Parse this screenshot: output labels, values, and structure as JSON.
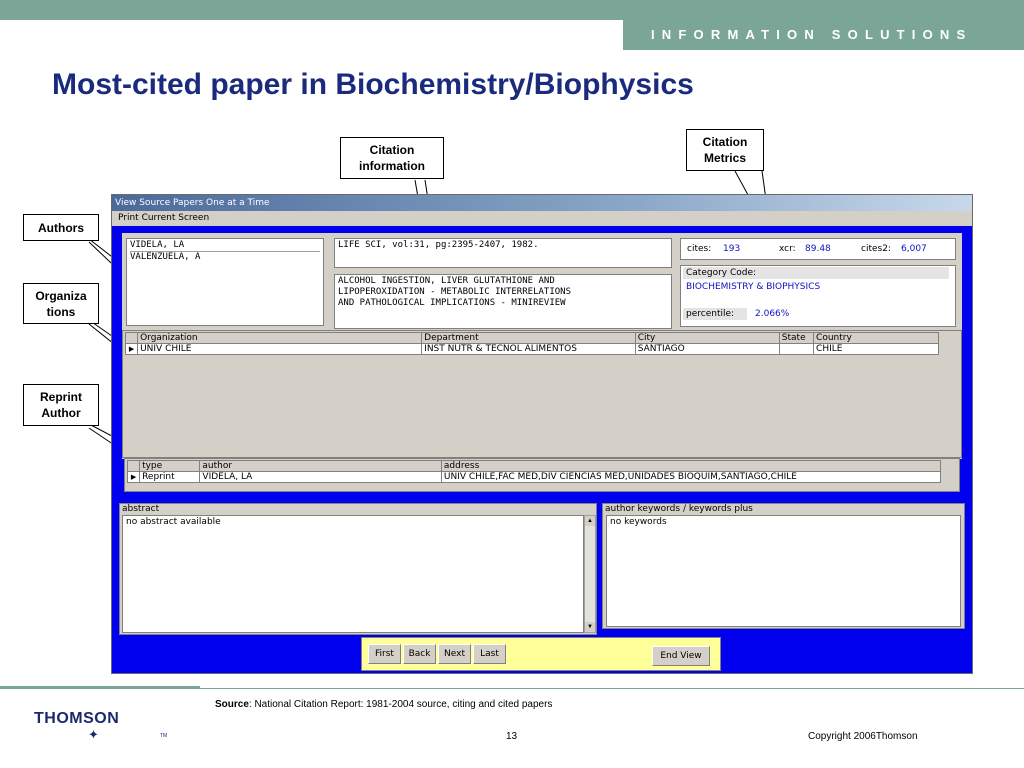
{
  "header": {
    "tagline": "INFORMATION SOLUTIONS",
    "title": "Most-cited paper in Biochemistry/Biophysics"
  },
  "callouts": {
    "citation_information": [
      "Citation",
      "information"
    ],
    "citation_metrics": [
      "Citation",
      "Metrics"
    ],
    "authors": "Authors",
    "organizations": [
      "Organiza",
      "tions"
    ],
    "reprint_author": [
      "Reprint",
      "Author"
    ]
  },
  "app": {
    "window_title": "View Source Papers One at a Time",
    "menu_item": "Print Current Screen",
    "authors": [
      "VIDELA, LA",
      "VALENZUELA, A"
    ],
    "source": "LIFE SCI, vol:31, pg:2395-2407, 1982.",
    "paper_title": [
      "ALCOHOL INGESTION, LIVER GLUTATHIONE AND",
      "LIPOPEROXIDATION - METABOLIC INTERRELATIONS",
      "AND PATHOLOGICAL IMPLICATIONS - MINIREVIEW"
    ],
    "metrics": {
      "cites_label": "cites:",
      "cites_value": "193",
      "xcr_label": "xcr:",
      "xcr_value": "89.48",
      "cites2_label": "cites2:",
      "cites2_value": "6,007",
      "category_label": "Category Code:",
      "category_value": "BIOCHEMISTRY & BIOPHYSICS",
      "percentile_label": "percentile:",
      "percentile_value": "2.066%"
    },
    "org_table": {
      "headers": [
        "Organization",
        "Department",
        "City",
        "State",
        "Country"
      ],
      "rows": [
        [
          "UNIV CHILE",
          "INST NUTR & TECNOL ALIMENTOS",
          "SANTIAGO",
          "",
          "CHILE"
        ]
      ]
    },
    "reprint_table": {
      "headers": [
        "type",
        "author",
        "address"
      ],
      "rows": [
        [
          "Reprint",
          "VIDELA, LA",
          "UNIV CHILE,FAC MED,DIV CIENCIAS MED,UNIDADES BIOQUIM,SANTIAGO,CHILE"
        ]
      ]
    },
    "abstract": {
      "label": "abstract",
      "text": "no abstract available"
    },
    "keywords": {
      "label": "author keywords / keywords plus",
      "text": "no keywords"
    },
    "nav_buttons": [
      "First",
      "Back",
      "Next",
      "Last"
    ],
    "end_view": "End View"
  },
  "footer": {
    "source_label": "Source",
    "source_text": ": National Citation Report:  1981-2004 source, citing and cited papers",
    "page_number": "13",
    "copyright": "Copyright 2006Thomson",
    "logo": "THOMSON",
    "logo_tm": "TM"
  },
  "colors": {
    "band": "#7aa597",
    "title": "#1a2a7c",
    "app_blue": "#0000ee",
    "panel_gray": "#d4d0c8",
    "nav_yellow": "#ffff99"
  }
}
